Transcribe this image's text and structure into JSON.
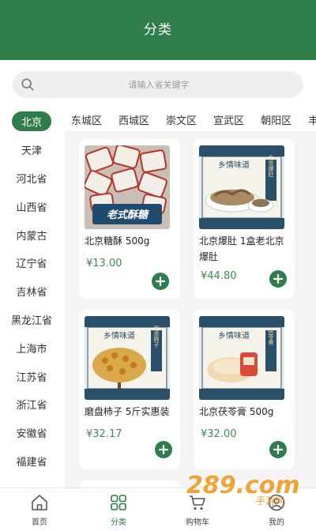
{
  "header": {
    "title": "分类"
  },
  "search": {
    "placeholder": "请输入省关键字"
  },
  "sidebar": {
    "items": [
      {
        "label": "北京",
        "active": true
      },
      {
        "label": "天津"
      },
      {
        "label": "河北省"
      },
      {
        "label": "山西省"
      },
      {
        "label": "内蒙古"
      },
      {
        "label": "辽宁省"
      },
      {
        "label": "吉林省"
      },
      {
        "label": "黑龙江省"
      },
      {
        "label": "上海市"
      },
      {
        "label": "江苏省"
      },
      {
        "label": "浙江省"
      },
      {
        "label": "安徽省"
      },
      {
        "label": "福建省"
      }
    ]
  },
  "tabs": [
    "东城区",
    "西城区",
    "崇文区",
    "宣武区",
    "朝阳区",
    "丰"
  ],
  "products": [
    {
      "name": "北京糖酥 500g",
      "price": "¥13.00",
      "image_caption": "老式酥糖"
    },
    {
      "name": "北京爆肚 1盒老北京爆肚",
      "price": "¥44.80",
      "image_caption": "乡情味道",
      "image_tag": "北京爆肚"
    },
    {
      "name": "磨盘柿子 5斤实惠装",
      "price": "¥32.17",
      "image_caption": "乡情味道",
      "image_tag": "磨盘柿子"
    },
    {
      "name": "北京茯苓膏 500g",
      "price": "¥32.00",
      "image_caption": "乡情味道",
      "image_tag": "茯苓膏"
    }
  ],
  "bottom_nav": [
    {
      "label": "首页",
      "icon": "home-icon"
    },
    {
      "label": "分类",
      "icon": "category-icon",
      "active": true
    },
    {
      "label": "购物车",
      "icon": "cart-icon"
    },
    {
      "label": "我的",
      "icon": "profile-icon"
    }
  ],
  "watermark": {
    "text": "289.com",
    "subtext": "手游网"
  },
  "colors": {
    "brand": "#2e7d4a",
    "price": "#3c8a57",
    "background": "#f4f4f4"
  }
}
